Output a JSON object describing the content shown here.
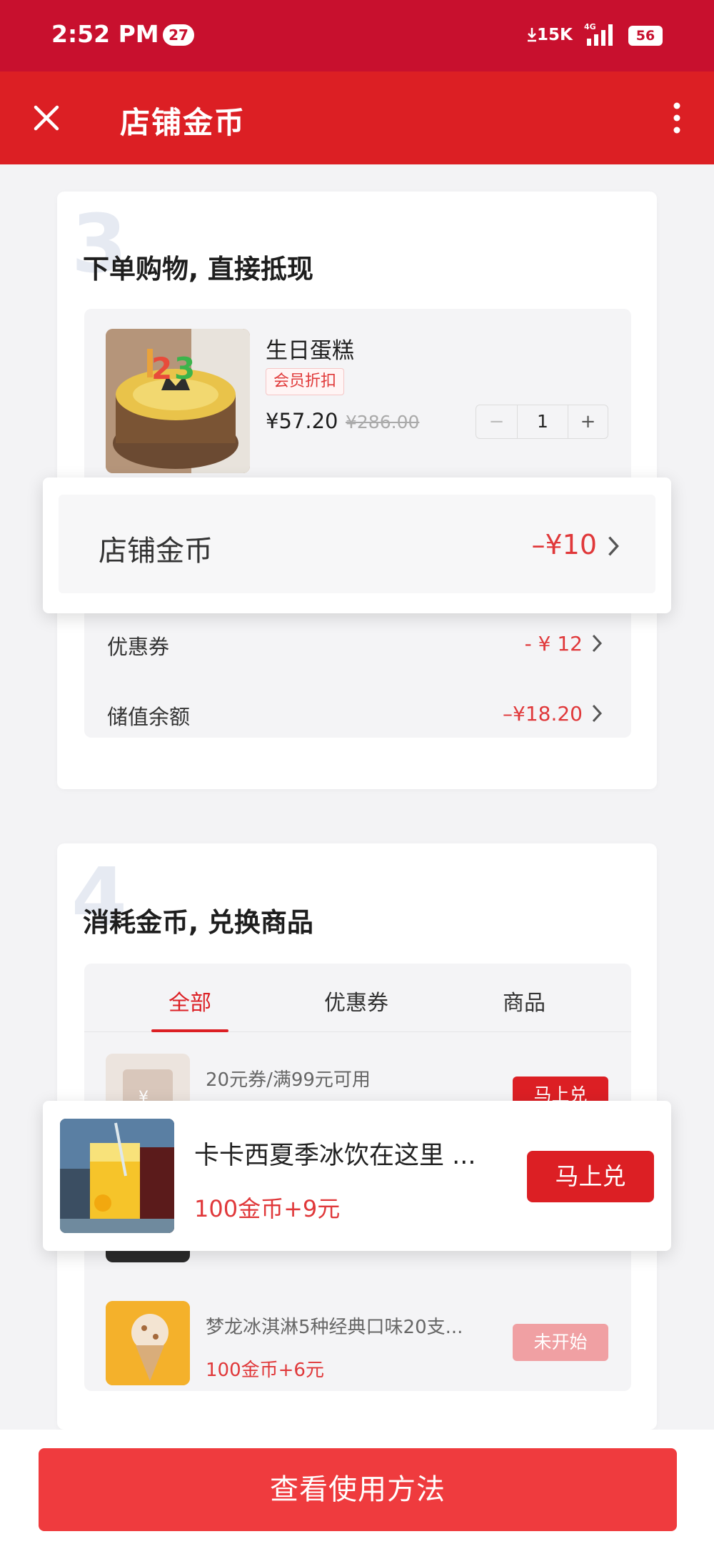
{
  "status_bar": {
    "time": "2:52 PM",
    "notification_count": "27",
    "net_speed": "15K",
    "network_type": "4G",
    "battery": "56",
    "icons": [
      "download-arrow-icon",
      "signal-icon",
      "battery-icon"
    ]
  },
  "app_bar": {
    "title": "店铺金币",
    "icons": [
      "close-icon",
      "more-icon"
    ]
  },
  "section3": {
    "step": "3",
    "title": "下单购物, 直接抵现",
    "product": {
      "name": "生日蛋糕",
      "tag": "会员折扣",
      "price": "¥57.20",
      "original_price": "¥286.00",
      "quantity": "1",
      "minus": "−",
      "plus": "+"
    },
    "coin_row": {
      "label": "店铺金币",
      "value": "–¥10"
    },
    "coupon_row": {
      "label": "优惠券",
      "value": "- ¥ 12"
    },
    "balance_row": {
      "label": "储值余额",
      "value": "–¥18.20"
    }
  },
  "section4": {
    "step": "4",
    "title": "消耗金币, 兑换商品",
    "tabs": [
      {
        "label": "全部",
        "active": true
      },
      {
        "label": "优惠券",
        "active": false
      },
      {
        "label": "商品",
        "active": false
      }
    ],
    "items": [
      {
        "name": "20元券/满99元可用",
        "button": "马上兑"
      },
      {
        "name": "卡卡西夏季冰饮在这里 ...",
        "price": "100金币+9元",
        "button": "马上兑"
      },
      {
        "name": "梦龙冰淇淋5种经典口味20支...",
        "price": "100金币+6元",
        "button": "未开始"
      }
    ]
  },
  "cta": {
    "label": "查看使用方法"
  },
  "colors": {
    "status_bar": "#c8102e",
    "app_bar": "#dc1f24",
    "accent_red": "#e0383a",
    "cta": "#ef3b3e",
    "disabled_button": "#f0a0a3"
  }
}
